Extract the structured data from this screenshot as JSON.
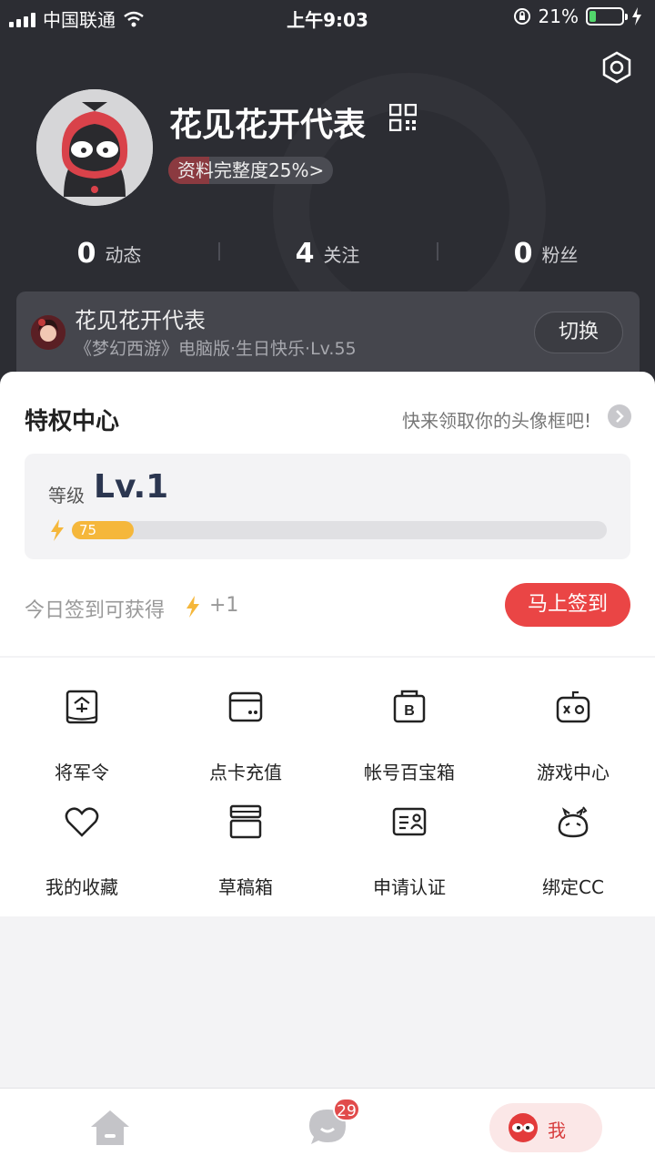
{
  "status_bar": {
    "carrier": "中国联通",
    "time": "上午9:03",
    "battery": "21%",
    "battery_level": 0.21
  },
  "profile": {
    "nickname": "花见花开代表",
    "completeness": "资料完整度25%>",
    "completeness_level": 0.25
  },
  "stats": [
    {
      "num": "0",
      "label": "动态"
    },
    {
      "num": "4",
      "label": "关注"
    },
    {
      "num": "0",
      "label": "粉丝"
    }
  ],
  "role": {
    "name": "花见花开代表",
    "sub": "《梦幻西游》电脑版·生日快乐·Lv.55",
    "switch": "切换"
  },
  "privilege": {
    "title": "特权中心",
    "hint": "快来领取你的头像框吧!",
    "level_label": "等级",
    "level_value": "Lv.1",
    "exp": "75",
    "exp_fraction": 0.09,
    "checkin_text": "今日签到可获得",
    "checkin_plus": "+1",
    "checkin_button": "马上签到"
  },
  "menu": [
    {
      "label": "将军令",
      "icon": "token-icon"
    },
    {
      "label": "点卡充值",
      "icon": "card-recharge-icon"
    },
    {
      "label": "帐号百宝箱",
      "icon": "treasure-box-icon"
    },
    {
      "label": "游戏中心",
      "icon": "gamepad-icon"
    },
    {
      "label": "我的收藏",
      "icon": "heart-icon"
    },
    {
      "label": "草稿箱",
      "icon": "drafts-icon"
    },
    {
      "label": "申请认证",
      "icon": "id-card-icon"
    },
    {
      "label": "绑定CC",
      "icon": "cc-icon"
    }
  ],
  "tabbar": {
    "badge": "29",
    "me_label": "我"
  }
}
